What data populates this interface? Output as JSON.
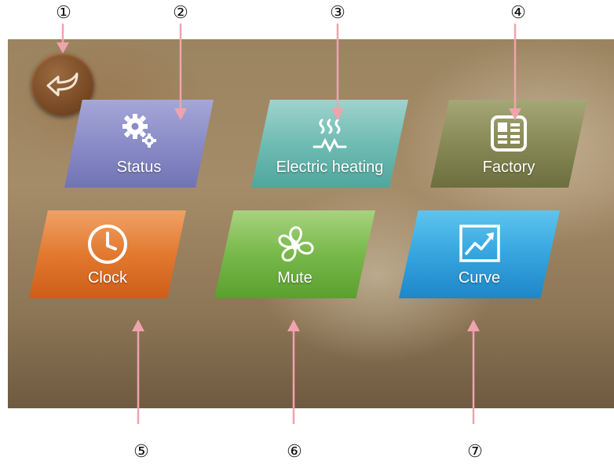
{
  "callouts": [
    "①",
    "②",
    "③",
    "④",
    "⑤",
    "⑥",
    "⑦"
  ],
  "menu": {
    "back_icon": "return-arrow-icon",
    "tiles": [
      {
        "label": "Status",
        "icon": "gears-icon",
        "color": "#8a8cc7"
      },
      {
        "label": "Electric heating",
        "icon": "heating-icon",
        "color": "#6fbcb3"
      },
      {
        "label": "Factory",
        "icon": "factory-panel-icon",
        "color": "#878a55"
      },
      {
        "label": "Clock",
        "icon": "clock-icon",
        "color": "#e2792f"
      },
      {
        "label": "Mute",
        "icon": "fan-icon",
        "color": "#78b84b"
      },
      {
        "label": "Curve",
        "icon": "chart-curve-icon",
        "color": "#35a5df"
      }
    ]
  },
  "colors": {
    "arrow": "#f0a3ad"
  }
}
